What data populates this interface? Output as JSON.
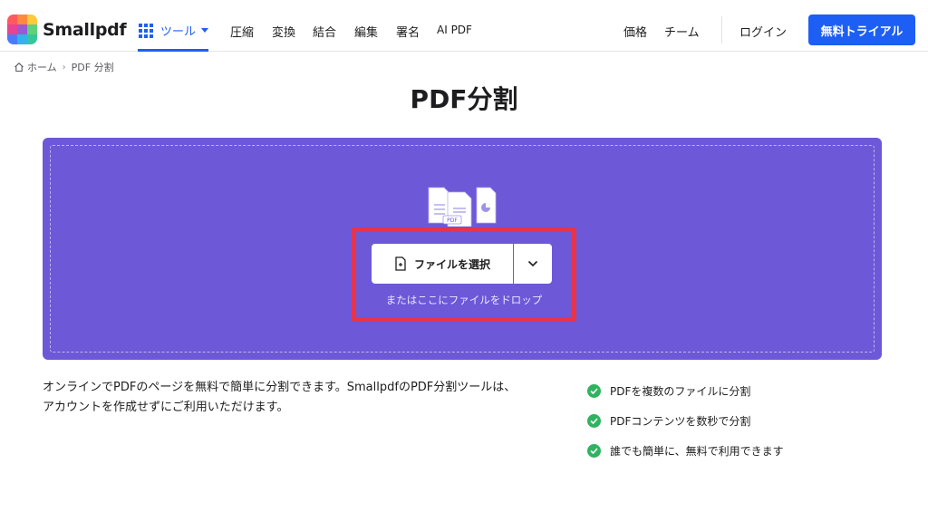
{
  "header": {
    "logo_text": "Smallpdf",
    "nav_tools_label": "ツール",
    "nav_items": [
      "圧縮",
      "変換",
      "結合",
      "編集",
      "署名",
      "AI PDF"
    ],
    "right_items": [
      "価格",
      "チーム"
    ],
    "login_label": "ログイン",
    "trial_label": "無料トライアル",
    "brand_color": "#1d5ff5"
  },
  "breadcrumb": {
    "home": "ホーム",
    "current": "PDF 分割"
  },
  "page_title": "PDF分割",
  "dropzone": {
    "bg_color": "#6d58d8",
    "illustration_label": "PDF",
    "select_button": "ファイルを選択",
    "drop_hint": "またはここにファイルをドロップ"
  },
  "description": "オンラインでPDFのページを無料で簡単に分割できます。SmallpdfのPDF分割ツールは、アカウントを作成せずにご利用いただけます。",
  "features": [
    "PDFを複数のファイルに分割",
    "PDFコンテンツを数秒で分割",
    "誰でも簡単に、無料で利用できます"
  ],
  "icons": [
    "tools-grid-icon",
    "home-icon",
    "file-add-icon",
    "chevron-down-icon",
    "check-circle-icon"
  ]
}
